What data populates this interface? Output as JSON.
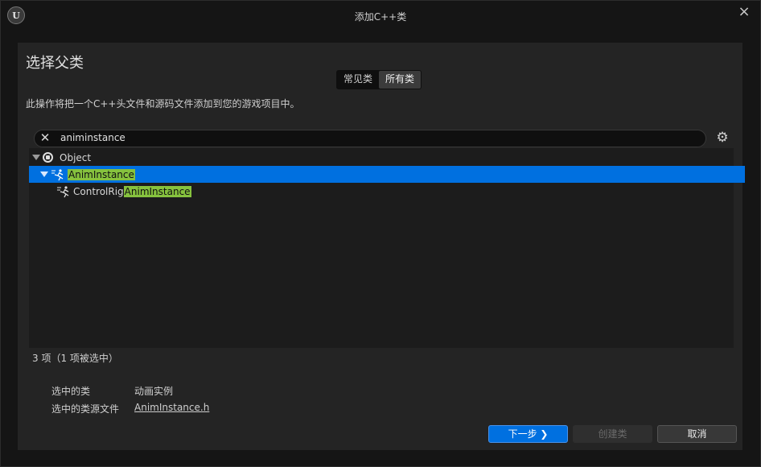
{
  "window": {
    "title": "添加C++类",
    "logo_text": "U",
    "close_icon": "×"
  },
  "dialog": {
    "heading": "选择父类",
    "tabs": [
      {
        "label": "常见类",
        "active": false
      },
      {
        "label": "所有类",
        "active": true
      }
    ],
    "description": "此操作将把一个C++头文件和源码文件添加到您的游戏项目中。"
  },
  "search": {
    "value": "animinstance",
    "clear_icon": "✕",
    "settings_icon": "⚙"
  },
  "tree": {
    "rows": [
      {
        "prefix": "Object",
        "match": "",
        "icon": "object-class-icon",
        "expanded": true,
        "selected": false
      },
      {
        "prefix": "",
        "match": "AnimInstance",
        "icon": "anim-instance-icon",
        "expanded": true,
        "selected": true
      },
      {
        "prefix": "ControlRig",
        "match": "AnimInstance",
        "icon": "anim-instance-icon",
        "expanded": false,
        "selected": false
      }
    ]
  },
  "status": {
    "count_text": "3 项（1 项被选中）"
  },
  "info": {
    "selected_class_label": "选中的类",
    "selected_class_value": "动画实例",
    "source_file_label": "选中的类源文件",
    "source_file_value": "AnimInstance.h"
  },
  "buttons": {
    "next": "下一步 ❯",
    "create": "创建类",
    "cancel": "取消"
  },
  "colors": {
    "accent": "#0070e0",
    "highlight": "#86c23e",
    "background": "#151515",
    "panel": "#242424"
  }
}
